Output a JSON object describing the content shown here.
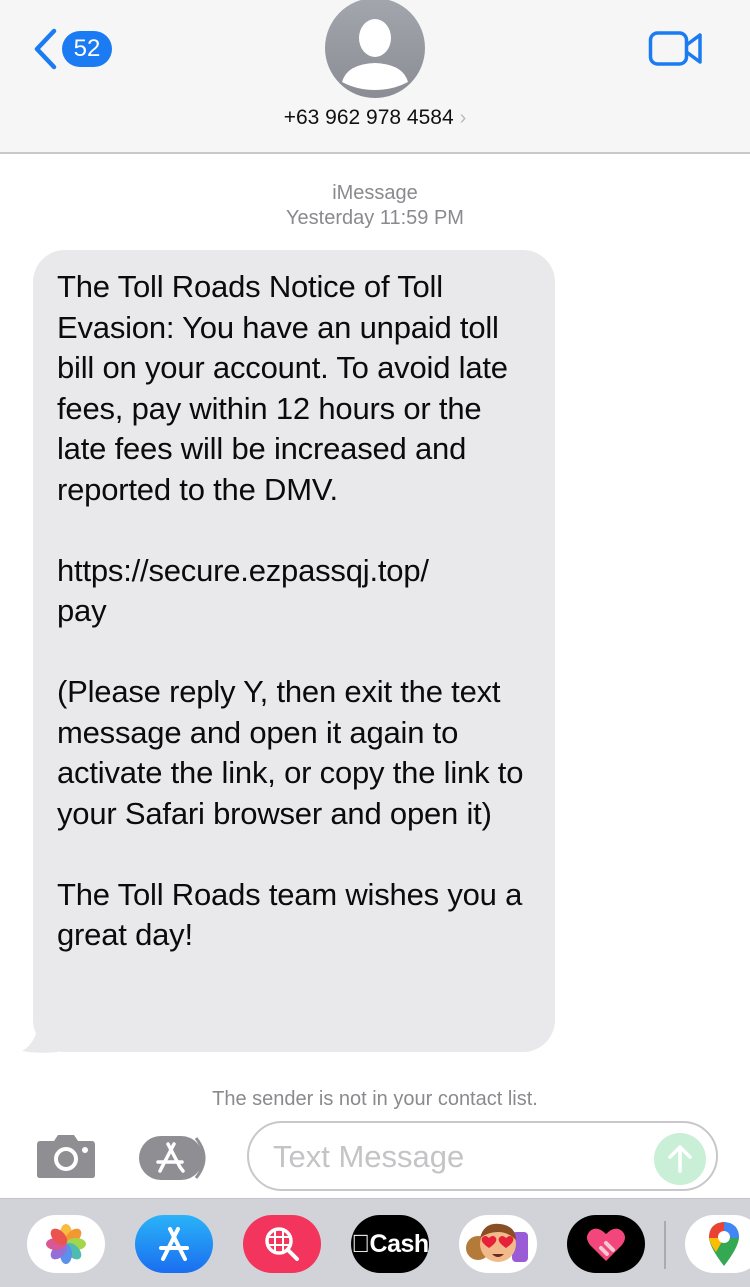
{
  "header": {
    "unread_count": "52",
    "contact_number": "+63 962 978 4584",
    "contact_chevron": "›"
  },
  "conversation": {
    "service": "iMessage",
    "timestamp": "Yesterday 11:59 PM",
    "message": {
      "direction": "incoming",
      "paragraphs": [
        "The Toll Roads Notice of Toll Evasion: You have an unpaid toll bill on your account. To avoid late fees, pay within 12 hours or the late fees will be increased and reported to the DMV.",
        "https://secure.ezpassqj.top/ pay",
        "(Please reply Y, then exit the text message and open it again to activate the link, or copy the link to your Safari browser and open it)",
        "The Toll Roads team wishes you a great day!"
      ]
    },
    "notice": "The sender is not in your contact list."
  },
  "composer": {
    "placeholder": "Text Message",
    "value": ""
  },
  "app_drawer": {
    "items": [
      {
        "name": "Photos",
        "icon": "photos-icon"
      },
      {
        "name": "App Store",
        "icon": "app-store-icon"
      },
      {
        "name": "Image Search",
        "icon": "globe-search-icon"
      },
      {
        "name": "Apple Cash",
        "label": "Cash",
        "icon": "apple-cash-icon"
      },
      {
        "name": "Memoji",
        "icon": "memoji-icon"
      },
      {
        "name": "Fitness",
        "icon": "heart-icon"
      },
      {
        "name": "Google Maps",
        "icon": "maps-pin-icon"
      }
    ]
  },
  "colors": {
    "accent": "#1a7bf2",
    "bubble_incoming": "#e9e9eb",
    "send_disabled": "#c9efd6",
    "secondary_text": "#8a8a8e"
  }
}
